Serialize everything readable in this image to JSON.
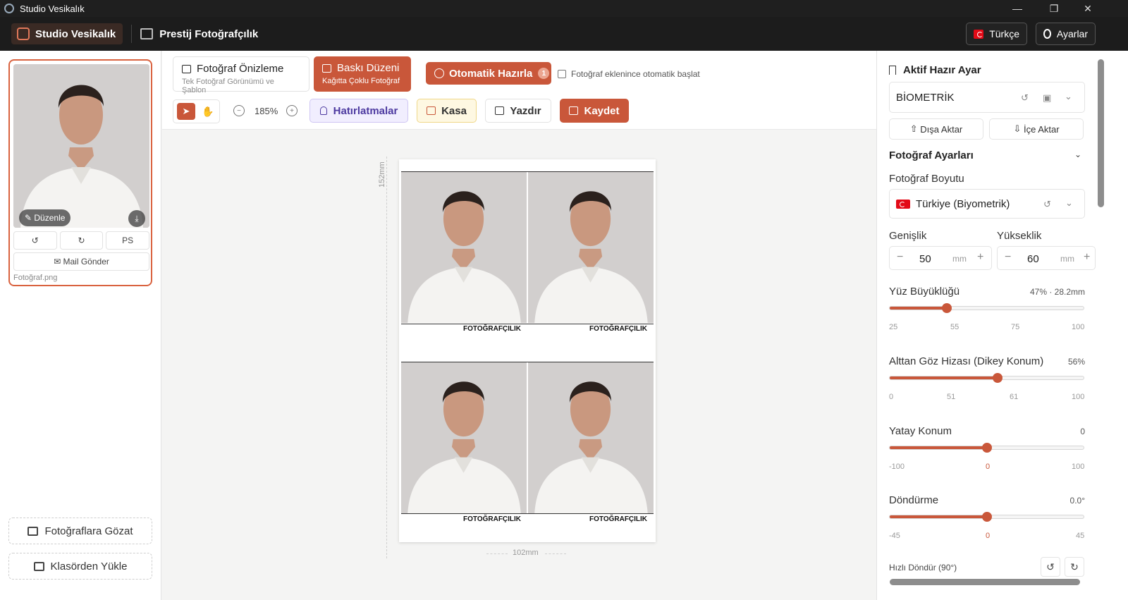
{
  "window": {
    "title": "Studio Vesikalık",
    "minimize": "—",
    "restore": "❐",
    "close": "✕"
  },
  "header": {
    "brand": "Studio Vesikalık",
    "studio": "Prestij Fotoğrafçılık",
    "language": "Türkçe",
    "settings": "Ayarlar"
  },
  "sidebar": {
    "edit_label": "Düzenle",
    "download_glyph": "⤓",
    "rotate_left": "↺",
    "rotate_right": "↻",
    "ps_label": "PS",
    "mail_label": "Mail Gönder",
    "mail_glyph": "✉",
    "file_name": "Fotoğraf.png",
    "browse_label": "Fotoğraflara Gözat",
    "folder_label": "Klasörden Yükle"
  },
  "toolbar": {
    "preview_title": "Fotoğraf Önizleme",
    "preview_sub": "Tek Fotoğraf Görünümü ve Şablon",
    "print_title": "Baskı Düzeni",
    "print_sub": "Kağıtta Çoklu Fotoğraf",
    "auto_label": "Otomatik Hazırla",
    "auto_badge": "1",
    "auto_check_label": "Fotoğraf eklenince otomatik başlat",
    "select_glyph": "➤",
    "hand_glyph": "✋",
    "zoom_out_glyph": "−",
    "zoom_in_glyph": "+",
    "zoom": "185%",
    "reminders": "Hatırlatmalar",
    "kasa": "Kasa",
    "print": "Yazdır",
    "save": "Kaydet"
  },
  "canvas": {
    "height_label": "152mm",
    "width_label": "102mm",
    "print_label": "FOTOĞRAFÇILIK"
  },
  "right_panel": {
    "active_preset_title": "Aktif Hazır Ayar",
    "preset_value": "BİOMETRİK",
    "reset_glyph": "↺",
    "save_glyph": "▣",
    "chevron_glyph": "⌄",
    "export_label": "Dışa Aktar",
    "import_label": "İçe Aktar",
    "export_glyph": "⇧",
    "import_glyph": "⇩",
    "photo_settings_title": "Fotoğraf Ayarları",
    "photo_size_label": "Fotoğraf Boyutu",
    "photo_size_value": "Türkiye (Biyometrik)",
    "width_label": "Genişlik",
    "height_label": "Yükseklik",
    "width_value": "50",
    "height_value": "60",
    "unit": "mm",
    "minus": "−",
    "plus": "+",
    "face_size_label": "Yüz Büyüklüğü",
    "face_size_value": "47% · 28.2mm",
    "face_size_fraction": 0.295,
    "face_ticks": [
      "25",
      "55",
      "75",
      "100"
    ],
    "eye_label": "Alttan Göz Hizası (Dikey Konum)",
    "eye_value": "56%",
    "eye_fraction": 0.555,
    "eye_ticks": [
      "0",
      "51",
      "61",
      "100"
    ],
    "horizontal_label": "Yatay Konum",
    "horizontal_value": "0",
    "horizontal_fraction": 0.5,
    "horizontal_ticks": [
      "-100",
      "0",
      "100"
    ],
    "rotation_label": "Döndürme",
    "rotation_value": "0.0°",
    "rotation_fraction": 0.5,
    "rotation_ticks": [
      "-45",
      "0",
      "45"
    ],
    "quick_rotate_label": "Hızlı Döndür (90°)"
  },
  "colors": {
    "accent": "#c9573a",
    "dark": "#1c1c1c"
  }
}
